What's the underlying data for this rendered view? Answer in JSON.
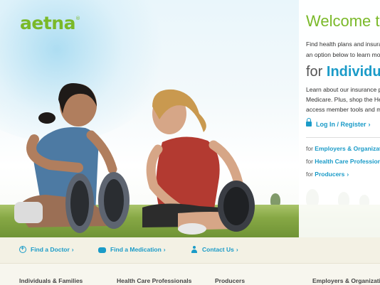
{
  "brand": {
    "logo_text": "aetna",
    "trademark": "®",
    "color": "#7ab929"
  },
  "hero": {
    "welcome": "Welcome to",
    "intro_lines": [
      "Find health plans and insura",
      "an option below to learn mo"
    ],
    "for_prefix": "for",
    "for_audience": "Individua",
    "learn_lines": [
      "Learn about our insurance p",
      "Medicare. Plus, shop the He",
      "access member tools and m"
    ],
    "login_label": "Log In / Register",
    "links": [
      {
        "prefix": "for",
        "label": "Employers & Organizatio"
      },
      {
        "prefix": "for",
        "label": "Health Care Professional"
      },
      {
        "prefix": "for",
        "label": "Producers"
      }
    ]
  },
  "quick_links": [
    {
      "label": "Find a Doctor",
      "icon": "plus-circle-icon"
    },
    {
      "label": "Find a Medication",
      "icon": "pill-icon"
    },
    {
      "label": "Contact Us",
      "icon": "person-icon"
    }
  ],
  "bottom_nav": [
    "Individuals & Families",
    "Health Care Professionals",
    "Producers",
    "Employers & Organizatio"
  ],
  "colors": {
    "link": "#1a9bc8",
    "accent_green": "#7ab929",
    "bar_bg": "#f3f1e4"
  }
}
